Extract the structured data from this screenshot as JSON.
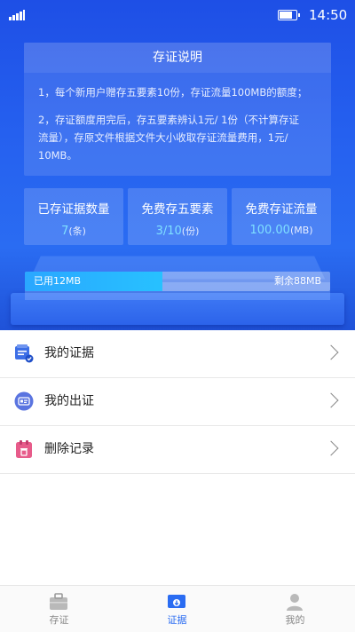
{
  "status_bar": {
    "time": "14:50"
  },
  "info": {
    "title": "存证说明",
    "line1": "1，每个新用户赠存五要素10份，存证流量100MB的额度；",
    "line2a": "2，存证额度用完后，存五要素辨认1元/ 1份（不计算存证",
    "line2b": "流量），存原文件根据文件大小收取存证流量费用，1元/",
    "line2c": "10MB。"
  },
  "stats": [
    {
      "label": "已存证据数量",
      "value": "7",
      "unit": "(条)"
    },
    {
      "label": "免费存五要素",
      "value": "3/10",
      "unit": "(份)"
    },
    {
      "label": "免费存证流量",
      "value": "100.00",
      "unit": "(MB)"
    }
  ],
  "usage": {
    "used_label": "已用12MB",
    "remaining_label": "剩余88MB",
    "used_fraction": 0.45
  },
  "menu": [
    {
      "label": "我的证据",
      "icon": "evidence-folder-icon"
    },
    {
      "label": "我的出证",
      "icon": "certificate-card-icon"
    },
    {
      "label": "删除记录",
      "icon": "delete-clipboard-icon"
    }
  ],
  "tabs": [
    {
      "label": "存证",
      "icon": "briefcase-icon"
    },
    {
      "label": "证据",
      "icon": "evidence-download-icon",
      "active": true
    },
    {
      "label": "我的",
      "icon": "person-icon"
    }
  ],
  "colors": {
    "primary": "#2a6cf2",
    "accent_value": "#7fe0ff",
    "progress": "#27c1ff"
  }
}
